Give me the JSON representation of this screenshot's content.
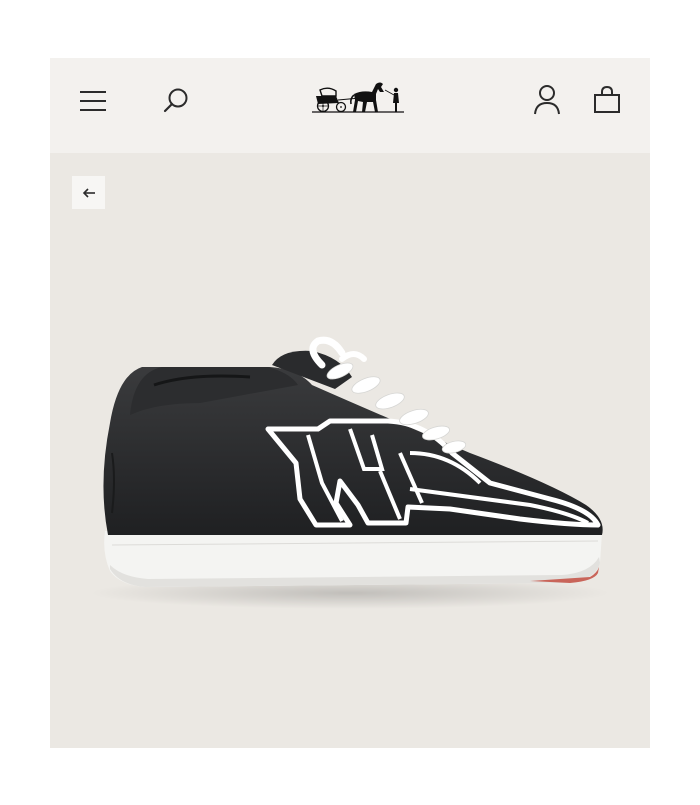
{
  "header": {
    "menu_icon": "hamburger-menu-icon",
    "search_icon": "search-icon",
    "logo": "hermes-carriage-logo",
    "account_icon": "user-account-icon",
    "bag_icon": "shopping-bag-icon"
  },
  "product_view": {
    "back_icon": "arrow-left-icon",
    "image": "black-leather-sneaker-side-view"
  },
  "colors": {
    "header_bg": "#f3f1ee",
    "stage_bg": "#ebe8e3",
    "shoe_black": "#2a2b2d",
    "outline_white": "#ffffff",
    "sole_accent": "#c9655a"
  }
}
